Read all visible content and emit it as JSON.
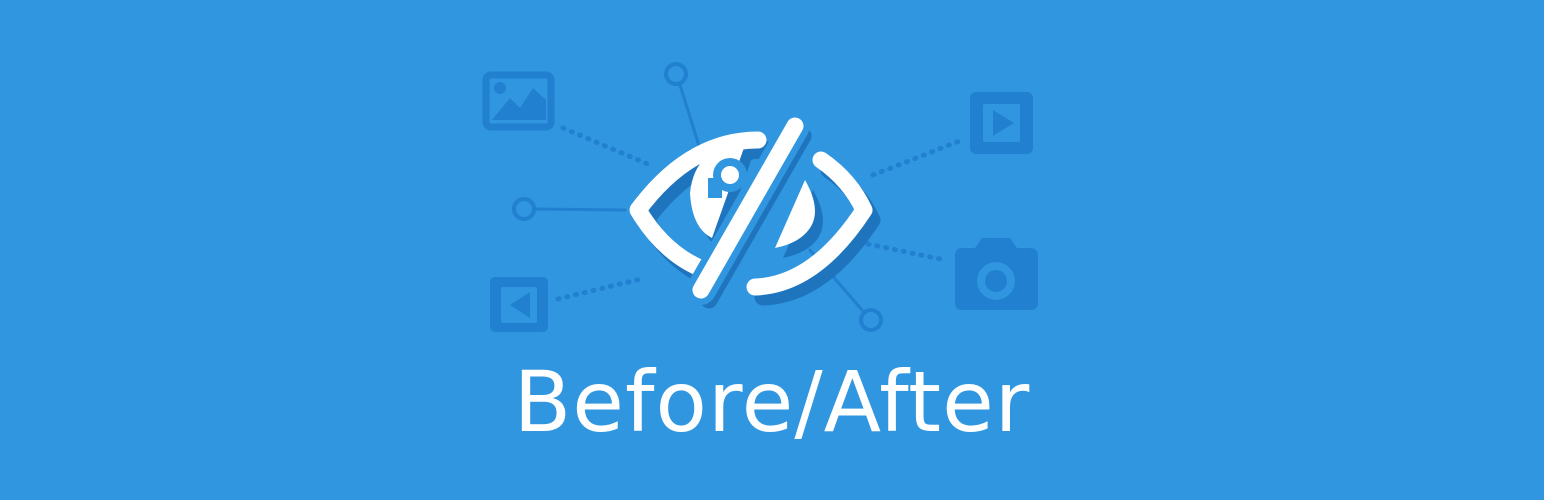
{
  "banner": {
    "title": "Before/After",
    "colors": {
      "background": "#3096e0",
      "icon_dark": "#2180cf",
      "shadow": "#1f75bd",
      "foreground": "#ffffff"
    },
    "icons": [
      "eye-slash-icon",
      "image-icon",
      "play-video-icon",
      "back-video-icon",
      "camera-icon"
    ]
  }
}
